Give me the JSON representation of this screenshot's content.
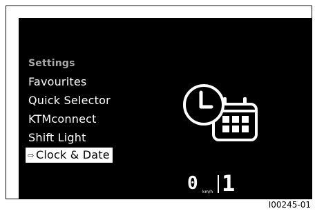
{
  "menu": {
    "header": "Settings",
    "items": [
      "Favourites",
      "Quick Selector",
      "KTMconnect",
      "Shift Light"
    ],
    "selected": "Clock & Date",
    "selected_marker": "⇨"
  },
  "icon": {
    "name": "clock-calendar-icon"
  },
  "status": {
    "speed": "0",
    "speed_unit": "km/h",
    "gear": "1"
  },
  "figure_id": "I00245-01",
  "colors": {
    "screen": "#000000",
    "text": "#ffffff",
    "header": "#a8a8a8",
    "selected_bg": "#ffffff"
  }
}
